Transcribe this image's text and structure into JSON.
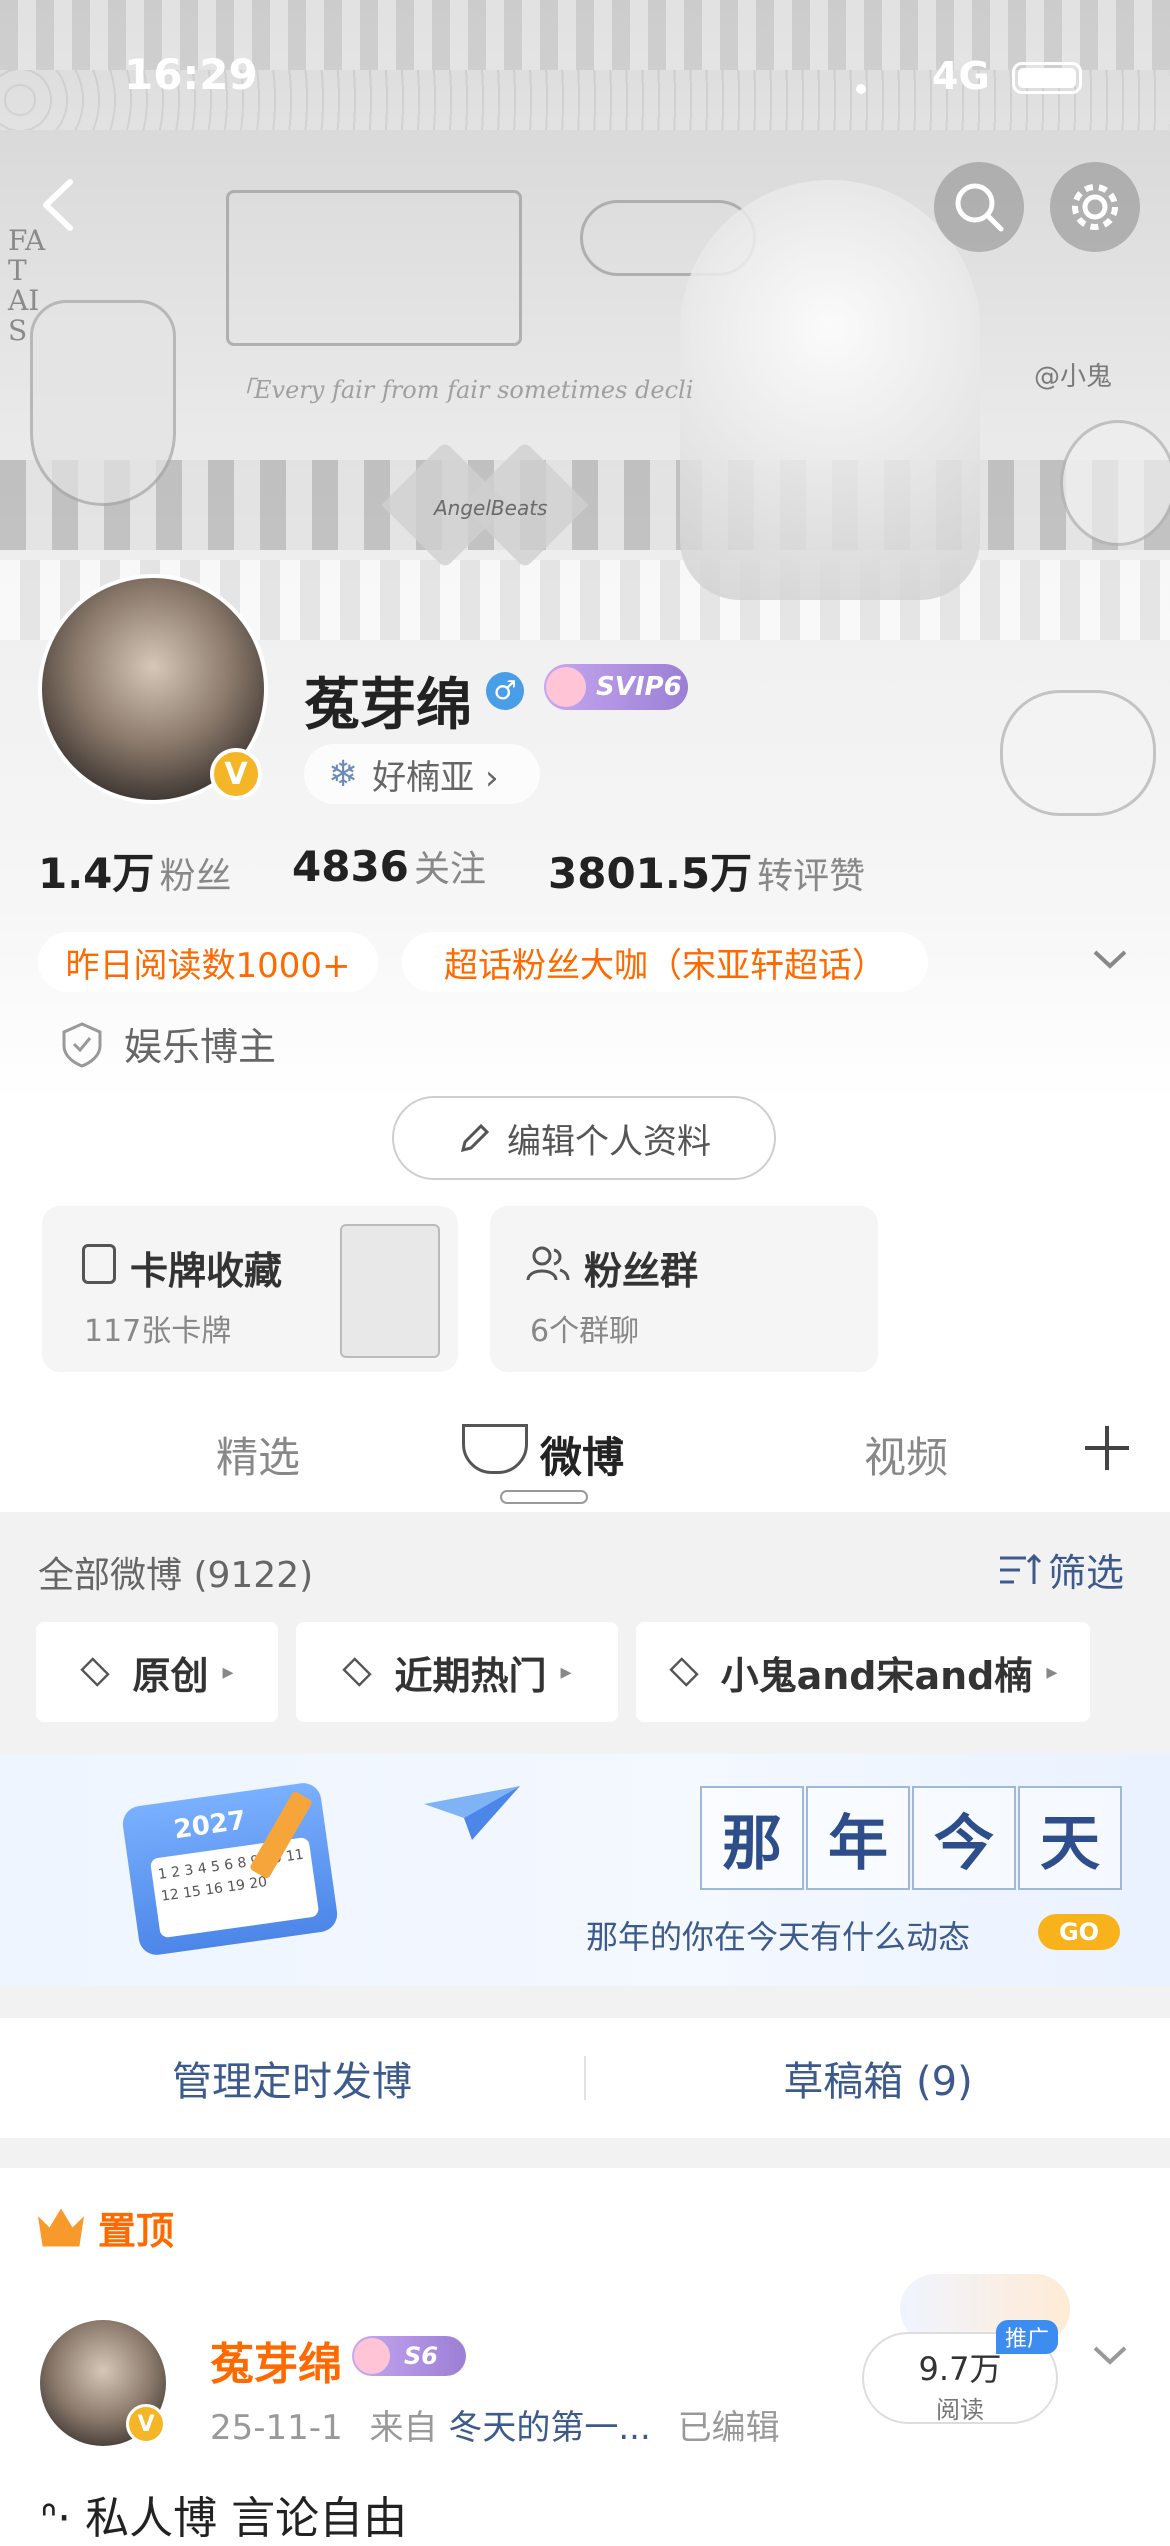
{
  "status_bar": {
    "time": "16:29",
    "network": "4G"
  },
  "header_art": {
    "watermark": "@小鬼",
    "quote": "「Every fair from fair sometimes decli",
    "plaque": "AngelBeats",
    "corner_text": "FAT AIS"
  },
  "profile": {
    "name": "菟芽绵",
    "vip_badge": "SVIP6",
    "friend_tag": "好楠亚 ›",
    "stats": [
      {
        "num": "1.4万",
        "label": "粉丝"
      },
      {
        "num": "4836",
        "label": "关注"
      },
      {
        "num": "3801.5万",
        "label": "转评赞"
      }
    ],
    "tags": [
      "昨日阅读数1000+",
      "超话粉丝大咖（宋亚轩超话）"
    ],
    "role": "娱乐博主",
    "edit_label": "编辑个人资料"
  },
  "cards": [
    {
      "title": "卡牌收藏",
      "sub": "117张卡牌"
    },
    {
      "title": "粉丝群",
      "sub": "6个群聊"
    }
  ],
  "tabs": [
    "精选",
    "微博",
    "视频"
  ],
  "feed": {
    "all_label": "全部微博 (9122)",
    "filter_label": "筛选",
    "chips": [
      "原创",
      "近期热门",
      "小鬼and宋and楠"
    ]
  },
  "banner": {
    "year": "2027",
    "chars": [
      "那",
      "年",
      "今",
      "天"
    ],
    "subtitle": "那年的你在今天有什么动态",
    "go": "GO",
    "calendar_numbers": "1 2 3 4 5 6 8 9 10 11 12 15 16 19 20"
  },
  "links": {
    "scheduled": "管理定时发博",
    "drafts": "草稿箱 (9)"
  },
  "pinned": {
    "label": "置顶",
    "author": "菟芽绵",
    "level": "S6",
    "date": "25-11-1",
    "source_prefix": "来自",
    "source": "冬天的第一...",
    "edited": "已编辑",
    "reads": "9.7万",
    "reads_label": "阅读",
    "promo": "推广",
    "content": "ᐢ· 私人博 言论自由"
  },
  "colors": {
    "accent_orange": "#ff6a00",
    "link_blue": "#3d5a8c",
    "vip_purple": "#9b7fd4",
    "badge_gold": "#f4b526"
  }
}
